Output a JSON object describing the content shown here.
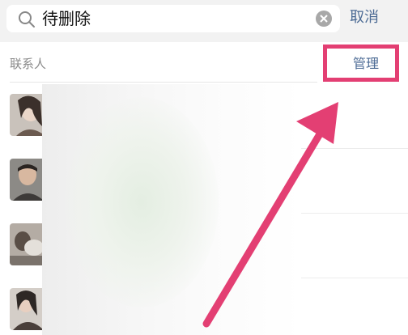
{
  "search": {
    "query": "待删除",
    "cancel_label": "取消"
  },
  "section": {
    "title": "联系人",
    "manage_label": "管理"
  },
  "contacts": [
    {
      "avatar": "avatar-1"
    },
    {
      "avatar": "avatar-2"
    },
    {
      "avatar": "avatar-3"
    },
    {
      "avatar": "avatar-4"
    }
  ],
  "colors": {
    "highlight": "#e33f73",
    "link": "#4b6a94",
    "search_bar_bg": "#f2f2f2"
  },
  "icons": {
    "search": "search-icon",
    "clear": "clear-icon",
    "annotation": "arrow-icon"
  }
}
